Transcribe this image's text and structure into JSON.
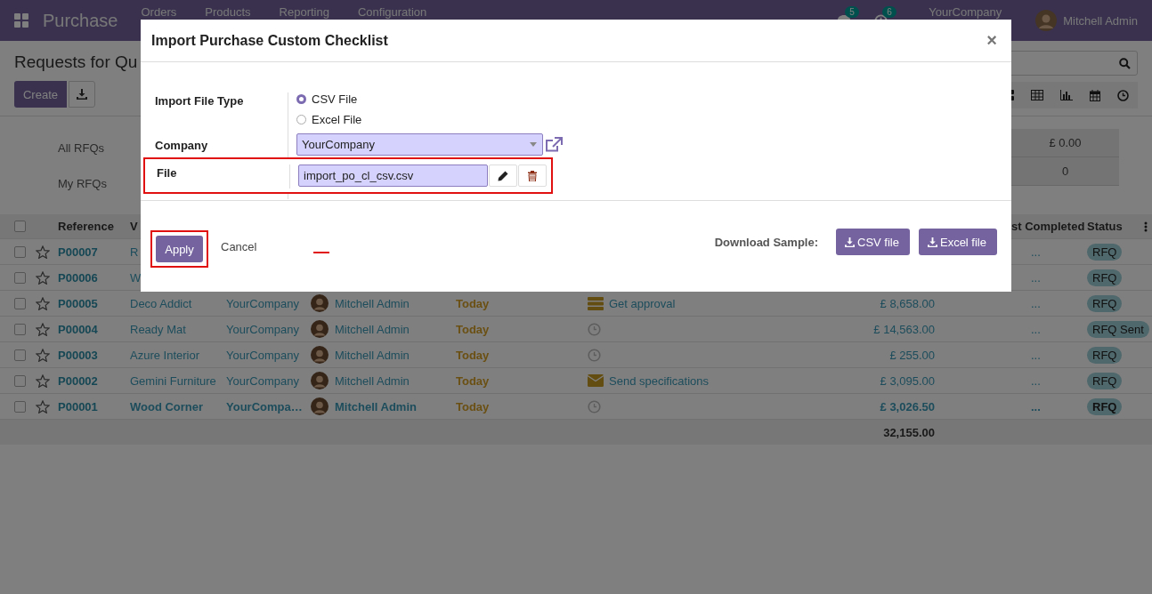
{
  "navbar": {
    "app_name": "Purchase",
    "menu": [
      "Orders",
      "Products",
      "Reporting",
      "Configuration"
    ],
    "messages_badge": "5",
    "activities_badge": "6",
    "company": "YourCompany",
    "user": "Mitchell Admin"
  },
  "control_panel": {
    "title": "Requests for Qu",
    "create_button": "Create"
  },
  "dashboard": [
    {
      "label": "All RFQs",
      "value": "£ 0.00"
    },
    {
      "label": "My RFQs",
      "value": "0"
    }
  ],
  "table": {
    "all_checked": false,
    "columns": [
      "Reference",
      "V",
      "st Completed",
      "Status"
    ],
    "rows": [
      {
        "reference": "P00007",
        "vendor": "R",
        "last_completed": "...",
        "status": "RFQ",
        "bold": false,
        "checked": false
      },
      {
        "reference": "P00006",
        "vendor": "W",
        "last_completed": "...",
        "status": "RFQ",
        "bold": false,
        "checked": false
      },
      {
        "reference": "P00005",
        "vendor": "Deco Addict",
        "company": "YourCompany",
        "representative": "Mitchell Admin",
        "deadline": "Today",
        "activity": {
          "kind": "approval",
          "label": "Get approval"
        },
        "total": "£ 8,658.00",
        "last_completed": "...",
        "status": "RFQ",
        "bold": false,
        "checked": false
      },
      {
        "reference": "P00004",
        "vendor": "Ready Mat",
        "company": "YourCompany",
        "representative": "Mitchell Admin",
        "deadline": "Today",
        "activity": {
          "kind": "clock"
        },
        "total": "£ 14,563.00",
        "last_completed": "...",
        "status": "RFQ Sent",
        "bold": false,
        "checked": false
      },
      {
        "reference": "P00003",
        "vendor": "Azure Interior",
        "company": "YourCompany",
        "representative": "Mitchell Admin",
        "deadline": "Today",
        "activity": {
          "kind": "clock"
        },
        "total": "£ 255.00",
        "last_completed": "...",
        "status": "RFQ",
        "bold": false,
        "checked": false
      },
      {
        "reference": "P00002",
        "vendor": "Gemini Furniture",
        "company": "YourCompany",
        "representative": "Mitchell Admin",
        "deadline": "Today",
        "activity": {
          "kind": "email",
          "label": "Send specifications"
        },
        "total": "£ 3,095.00",
        "last_completed": "...",
        "status": "RFQ",
        "bold": false,
        "checked": false
      },
      {
        "reference": "P00001",
        "vendor": "Wood Corner",
        "company": "YourCompa…",
        "representative": "Mitchell Admin",
        "deadline": "Today",
        "activity": {
          "kind": "clock"
        },
        "total": "£ 3,026.50",
        "last_completed": "...",
        "status": "RFQ",
        "bold": true,
        "checked": false
      }
    ],
    "total": "32,155.00"
  },
  "modal": {
    "title": "Import Purchase Custom Checklist",
    "close": "×",
    "import_file_type": {
      "label": "Import File Type",
      "options": [
        {
          "label": "CSV File",
          "selected": true
        },
        {
          "label": "Excel File",
          "selected": false
        }
      ]
    },
    "company": {
      "label": "Company",
      "value": "YourCompany"
    },
    "file": {
      "label": "File",
      "value": "import_po_cl_csv.csv",
      "highlighted": true
    },
    "apply": {
      "label": "Apply",
      "highlighted": true
    },
    "cancel": "Cancel",
    "download_label": "Download Sample:",
    "sample_buttons": [
      "CSV file",
      "Excel file"
    ]
  }
}
